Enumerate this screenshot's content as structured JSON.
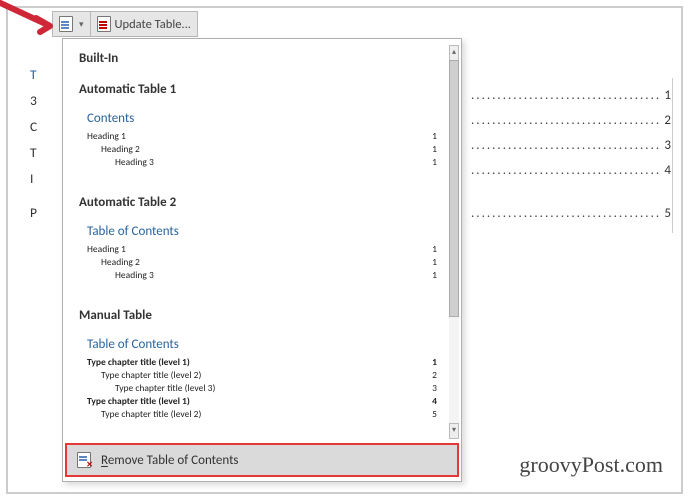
{
  "toolbar": {
    "update_label": "Update Table..."
  },
  "left_margin": [
    "T",
    "3",
    "C",
    "T",
    "I",
    "P"
  ],
  "bg_numbers": [
    "1",
    "2",
    "3",
    "4",
    "5"
  ],
  "menu": {
    "builtin_label": "Built-In",
    "auto1": {
      "title": "Automatic Table 1",
      "contents_title": "Contents",
      "rows": [
        {
          "label": "Heading 1",
          "page": "1",
          "ind": "ind1"
        },
        {
          "label": "Heading 2",
          "page": "1",
          "ind": "ind2"
        },
        {
          "label": "Heading 3",
          "page": "1",
          "ind": "ind3"
        }
      ]
    },
    "auto2": {
      "title": "Automatic Table 2",
      "contents_title": "Table of Contents",
      "rows": [
        {
          "label": "Heading 1",
          "page": "1",
          "ind": "ind1"
        },
        {
          "label": "Heading 2",
          "page": "1",
          "ind": "ind2"
        },
        {
          "label": "Heading 3",
          "page": "1",
          "ind": "ind3"
        }
      ]
    },
    "manual": {
      "title": "Manual Table",
      "contents_title": "Table of Contents",
      "rows": [
        {
          "label": "Type chapter title (level 1)",
          "page": "1",
          "ind": "ind1",
          "bold": true
        },
        {
          "label": "Type chapter title (level 2)",
          "page": "2",
          "ind": "ind2"
        },
        {
          "label": "Type chapter title (level 3)",
          "page": "3",
          "ind": "ind3"
        },
        {
          "label": "Type chapter title (level 1)",
          "page": "4",
          "ind": "ind1",
          "bold": true
        },
        {
          "label": "Type chapter title (level 2)",
          "page": "5",
          "ind": "ind2"
        }
      ]
    },
    "remove_prefix": "R",
    "remove_rest": "emove Table of Contents"
  },
  "watermark": "groovyPost.com"
}
